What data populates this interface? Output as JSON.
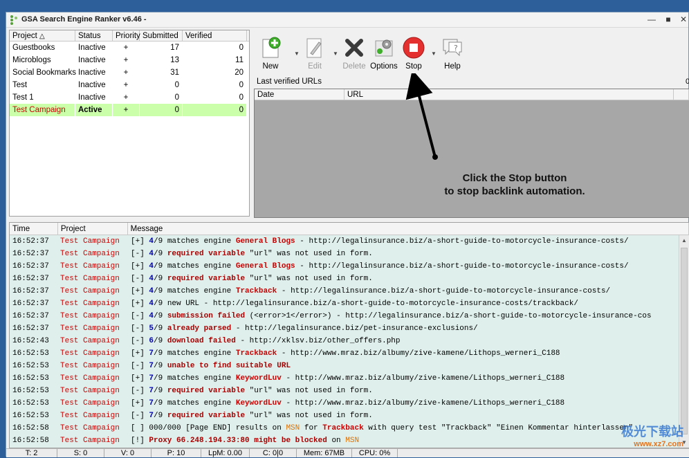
{
  "window": {
    "title": "GSA Search Engine Ranker v6.46 -"
  },
  "projects": {
    "headers": [
      "Project",
      "Status",
      "Priority",
      "Submitted",
      "Verified"
    ],
    "sort_icon": "triangle-up-icon",
    "rows": [
      {
        "name": "Guestbooks",
        "status": "Inactive",
        "priority": "+",
        "submitted": "17",
        "verified": "0"
      },
      {
        "name": "Microblogs",
        "status": "Inactive",
        "priority": "+",
        "submitted": "13",
        "verified": "11"
      },
      {
        "name": "Social Bookmarks",
        "status": "Inactive",
        "priority": "+",
        "submitted": "31",
        "verified": "20"
      },
      {
        "name": "Test",
        "status": "Inactive",
        "priority": "+",
        "submitted": "0",
        "verified": "0"
      },
      {
        "name": "Test 1",
        "status": "Inactive",
        "priority": "+",
        "submitted": "0",
        "verified": "0"
      },
      {
        "name": "Test Campaign",
        "status": "Active",
        "priority": "+",
        "submitted": "0",
        "verified": "0"
      }
    ]
  },
  "toolbar": {
    "new": "New",
    "edit": "Edit",
    "delete": "Delete",
    "options": "Options",
    "stop": "Stop",
    "help": "Help"
  },
  "urls": {
    "label": "Last verified URLs",
    "headers": [
      "Date",
      "URL"
    ],
    "counter": "0"
  },
  "hint": {
    "line1": "Click the Stop button",
    "line2": "to stop backlink automation."
  },
  "log": {
    "headers": [
      "Time",
      "Project",
      "Message"
    ],
    "rows": [
      {
        "time": "16:52:37",
        "project": "Test Campaign",
        "parts": [
          [
            "[+] ",
            ""
          ],
          [
            "4",
            "ok"
          ],
          [
            "/9 matches engine ",
            ""
          ],
          [
            "General Blogs",
            "eng"
          ],
          [
            " - http://legalinsurance.biz/a-short-guide-to-motorcycle-insurance-costs/",
            ""
          ]
        ]
      },
      {
        "time": "16:52:37",
        "project": "Test Campaign",
        "parts": [
          [
            "[-] ",
            ""
          ],
          [
            "4",
            "ok"
          ],
          [
            "/9 ",
            ""
          ],
          [
            "required variable",
            "bad"
          ],
          [
            " \"url\" was not used in form.",
            ""
          ]
        ]
      },
      {
        "time": "16:52:37",
        "project": "Test Campaign",
        "parts": [
          [
            "[+] ",
            ""
          ],
          [
            "4",
            "ok"
          ],
          [
            "/9 matches engine ",
            ""
          ],
          [
            "General Blogs",
            "eng"
          ],
          [
            " - http://legalinsurance.biz/a-short-guide-to-motorcycle-insurance-costs/",
            ""
          ]
        ]
      },
      {
        "time": "16:52:37",
        "project": "Test Campaign",
        "parts": [
          [
            "[-] ",
            ""
          ],
          [
            "4",
            "ok"
          ],
          [
            "/9 ",
            ""
          ],
          [
            "required variable",
            "bad"
          ],
          [
            " \"url\" was not used in form.",
            ""
          ]
        ]
      },
      {
        "time": "16:52:37",
        "project": "Test Campaign",
        "parts": [
          [
            "[+] ",
            ""
          ],
          [
            "4",
            "ok"
          ],
          [
            "/9 matches engine ",
            ""
          ],
          [
            "Trackback",
            "eng"
          ],
          [
            " - http://legalinsurance.biz/a-short-guide-to-motorcycle-insurance-costs/",
            ""
          ]
        ]
      },
      {
        "time": "16:52:37",
        "project": "Test Campaign",
        "parts": [
          [
            "[+] ",
            ""
          ],
          [
            "4",
            "ok"
          ],
          [
            "/9 new URL - http://legalinsurance.biz/a-short-guide-to-motorcycle-insurance-costs/trackback/",
            ""
          ]
        ]
      },
      {
        "time": "16:52:37",
        "project": "Test Campaign",
        "parts": [
          [
            "[-] ",
            ""
          ],
          [
            "4",
            "ok"
          ],
          [
            "/9 ",
            ""
          ],
          [
            "submission failed",
            "bad"
          ],
          [
            " (<error>1</error>) - http://legalinsurance.biz/a-short-guide-to-motorcycle-insurance-cos",
            ""
          ]
        ]
      },
      {
        "time": "16:52:37",
        "project": "Test Campaign",
        "parts": [
          [
            "[-] ",
            ""
          ],
          [
            "5",
            "ok"
          ],
          [
            "/9 ",
            ""
          ],
          [
            "already parsed",
            "bad"
          ],
          [
            " - http://legalinsurance.biz/pet-insurance-exclusions/",
            ""
          ]
        ]
      },
      {
        "time": "16:52:43",
        "project": "Test Campaign",
        "parts": [
          [
            "[-] ",
            ""
          ],
          [
            "6",
            "ok"
          ],
          [
            "/9 ",
            ""
          ],
          [
            "download failed",
            "bad"
          ],
          [
            " - http://xklsv.biz/other_offers.php",
            ""
          ]
        ]
      },
      {
        "time": "16:52:53",
        "project": "Test Campaign",
        "parts": [
          [
            "[+] ",
            ""
          ],
          [
            "7",
            "ok"
          ],
          [
            "/9 matches engine ",
            ""
          ],
          [
            "Trackback",
            "eng"
          ],
          [
            " - http://www.mraz.biz/albumy/zive-kamene/Lithops_werneri_C188",
            ""
          ]
        ]
      },
      {
        "time": "16:52:53",
        "project": "Test Campaign",
        "parts": [
          [
            "[-] ",
            ""
          ],
          [
            "7",
            "ok"
          ],
          [
            "/9 ",
            ""
          ],
          [
            "unable to find suitable URL",
            "bad"
          ]
        ]
      },
      {
        "time": "16:52:53",
        "project": "Test Campaign",
        "parts": [
          [
            "[+] ",
            ""
          ],
          [
            "7",
            "ok"
          ],
          [
            "/9 matches engine ",
            ""
          ],
          [
            "KeywordLuv",
            "eng"
          ],
          [
            " - http://www.mraz.biz/albumy/zive-kamene/Lithops_werneri_C188",
            ""
          ]
        ]
      },
      {
        "time": "16:52:53",
        "project": "Test Campaign",
        "parts": [
          [
            "[-] ",
            ""
          ],
          [
            "7",
            "ok"
          ],
          [
            "/9 ",
            ""
          ],
          [
            "required variable",
            "bad"
          ],
          [
            " \"url\" was not used in form.",
            ""
          ]
        ]
      },
      {
        "time": "16:52:53",
        "project": "Test Campaign",
        "parts": [
          [
            "[+] ",
            ""
          ],
          [
            "7",
            "ok"
          ],
          [
            "/9 matches engine ",
            ""
          ],
          [
            "KeywordLuv",
            "eng"
          ],
          [
            " - http://www.mraz.biz/albumy/zive-kamene/Lithops_werneri_C188",
            ""
          ]
        ]
      },
      {
        "time": "16:52:53",
        "project": "Test Campaign",
        "parts": [
          [
            "[-] ",
            ""
          ],
          [
            "7",
            "ok"
          ],
          [
            "/9 ",
            ""
          ],
          [
            "required variable",
            "bad"
          ],
          [
            " \"url\" was not used in form.",
            ""
          ]
        ]
      },
      {
        "time": "16:52:58",
        "project": "Test Campaign",
        "parts": [
          [
            "[ ] 000/000 [Page END] results on ",
            ""
          ],
          [
            "MSN",
            "orange"
          ],
          [
            " for ",
            ""
          ],
          [
            "Trackback",
            "eng"
          ],
          [
            " with query test \"Trackback\" \"Einen Kommentar hinterlassen\"",
            ""
          ]
        ]
      },
      {
        "time": "16:52:58",
        "project": "Test Campaign",
        "parts": [
          [
            "[!] ",
            ""
          ],
          [
            "Proxy 66.248.194.33:80 might be blocked",
            "bad"
          ],
          [
            " on ",
            ""
          ],
          [
            "MSN",
            "orange"
          ]
        ]
      }
    ]
  },
  "status": {
    "threads": "T: 2",
    "submitted": "S: 0",
    "verified": "V: 0",
    "proxies": "P: 10",
    "lpm": "LpM: 0.00",
    "captcha": "C: 0|0",
    "mem": "Mem: 67MB",
    "cpu": "CPU: 0%"
  },
  "watermark": {
    "line1": "极光下载站",
    "line2": "www.xz7.com"
  },
  "colors": {
    "accent_red": "#cc0000",
    "active_row": "#ccffaa",
    "log_bg": "#dff0ec"
  }
}
